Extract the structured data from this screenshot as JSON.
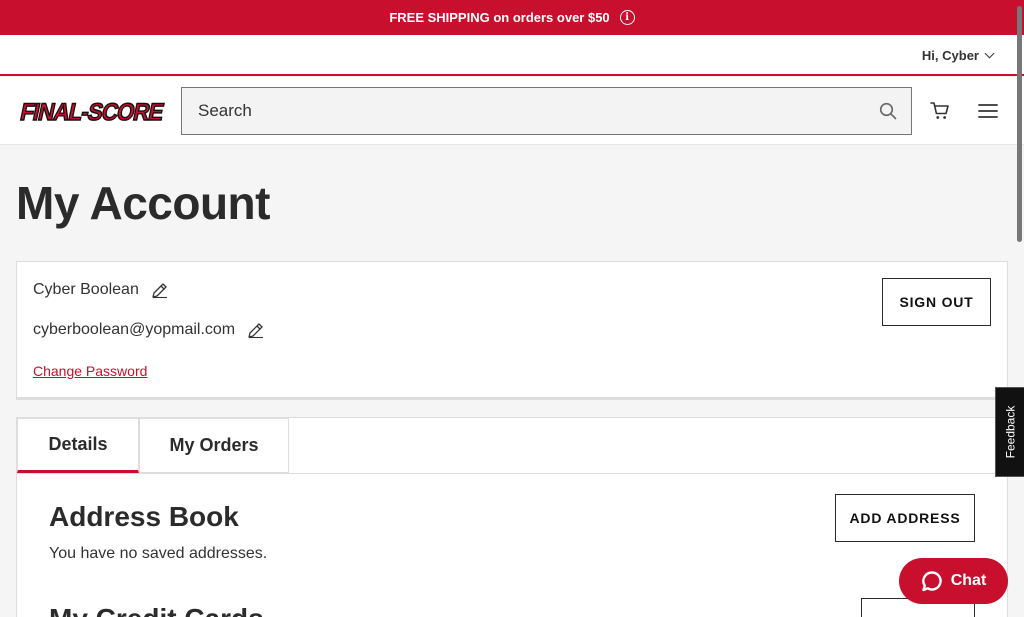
{
  "promo": {
    "text": "FREE SHIPPING on orders over $50",
    "info_glyph": "i"
  },
  "utility": {
    "greeting": "Hi, Cyber"
  },
  "header": {
    "logo_alt": "FINAL-SCORE",
    "search_placeholder": "Search"
  },
  "page": {
    "title": "My Account"
  },
  "account": {
    "name": "Cyber Boolean",
    "email": "cyberboolean@yopmail.com",
    "change_password": "Change Password",
    "sign_out": "SIGN OUT"
  },
  "tabs": [
    {
      "label": "Details",
      "active": true
    },
    {
      "label": "My Orders",
      "active": false
    }
  ],
  "address_book": {
    "title": "Address Book",
    "empty": "You have no saved addresses.",
    "add_label": "ADD ADDRESS"
  },
  "credit_cards": {
    "title": "My Credit Cards"
  },
  "feedback": {
    "label": "Feedback"
  },
  "chat": {
    "label": "Chat"
  },
  "colors": {
    "brand": "#c8102e",
    "text": "#2b2b2b",
    "background": "#f5f5f5"
  }
}
